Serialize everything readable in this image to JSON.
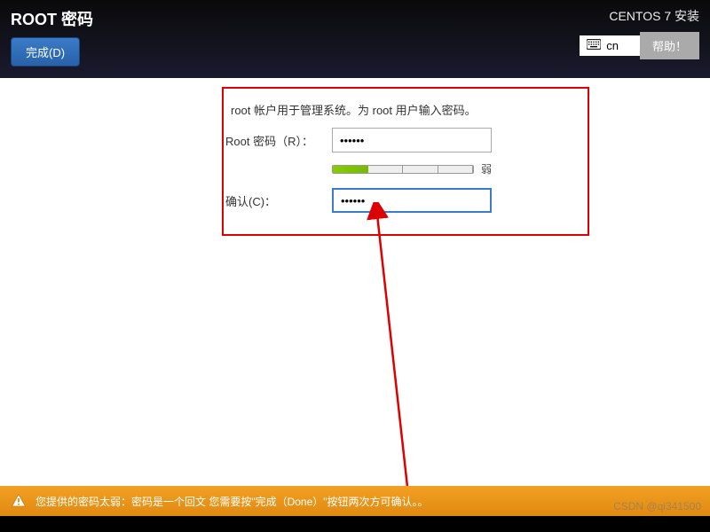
{
  "header": {
    "title": "ROOT 密码",
    "done_label": "完成(D)",
    "install_title": "CENTOS 7 安装",
    "lang": "cn",
    "help_label": "帮助！"
  },
  "form": {
    "instruction": "root 帐户用于管理系统。为 root 用户输入密码。",
    "root_label": "Root 密码（R）：",
    "root_value": "••••••",
    "confirm_label": "确认(C)：",
    "confirm_value": "••••••",
    "strength_label": "弱"
  },
  "footer": {
    "warning": "您提供的密码太弱：密码是一个回文 您需要按\"完成（Done）\"按钮两次方可确认。。"
  },
  "watermark": "CSDN @qi341500"
}
